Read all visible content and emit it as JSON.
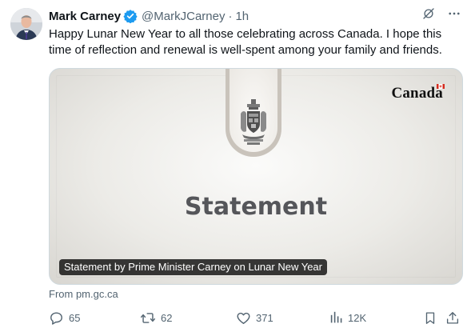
{
  "author": {
    "name": "Mark Carney",
    "handle": "@MarkJCarney",
    "separator": "·",
    "time": "1h",
    "verified": true
  },
  "tweet_text": "Happy Lunar New Year to all those celebrating across Canada. I hope this time of reflection and renewal is well-spent among your family and friends.",
  "card": {
    "brand": "Canada",
    "title": "Statement",
    "caption": "Statement by Prime Minister Carney on Lunar New Year",
    "source": "From pm.gc.ca"
  },
  "actions": {
    "replies": "65",
    "reposts": "62",
    "likes": "371",
    "views": "12K"
  },
  "colors": {
    "text": "#0f1419",
    "muted": "#536471",
    "verified_blue": "#1d9bf0",
    "border": "#cfd9de"
  },
  "icons": [
    "verified-badge-icon",
    "grok-icon",
    "more-icon",
    "reply-icon",
    "repost-icon",
    "like-icon",
    "views-icon",
    "bookmark-icon",
    "share-icon"
  ]
}
